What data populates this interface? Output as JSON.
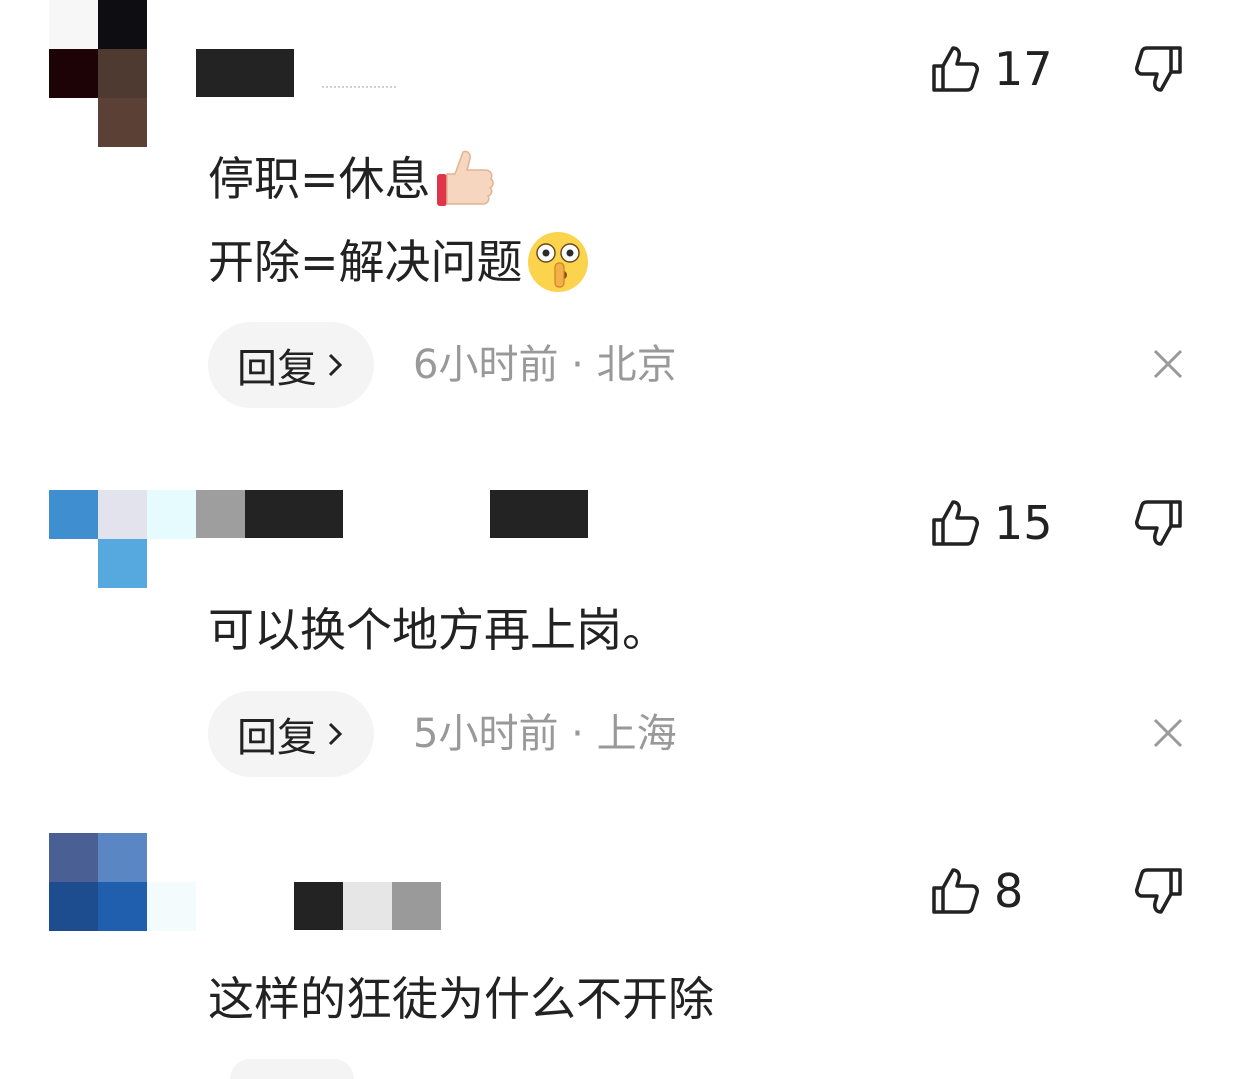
{
  "comments": [
    {
      "likes": "17",
      "lines": [
        "停职=休息",
        "开除=解决问题"
      ],
      "emojis": [
        "thumbs-up-emoji",
        "shushing-face-emoji"
      ],
      "reply_label": "回复",
      "time": "6小时前",
      "location": "北京"
    },
    {
      "likes": "15",
      "lines": [
        "可以换个地方再上岗。"
      ],
      "reply_label": "回复",
      "time": "5小时前",
      "location": "上海"
    },
    {
      "likes": "8",
      "lines": [
        "这样的狂徒为什么不开除"
      ]
    }
  ],
  "separator": " · ",
  "icons": {
    "like": "thumbs-up-outline-icon",
    "dislike": "thumbs-down-outline-icon",
    "close": "close-icon",
    "chevron": "chevron-right-icon"
  }
}
